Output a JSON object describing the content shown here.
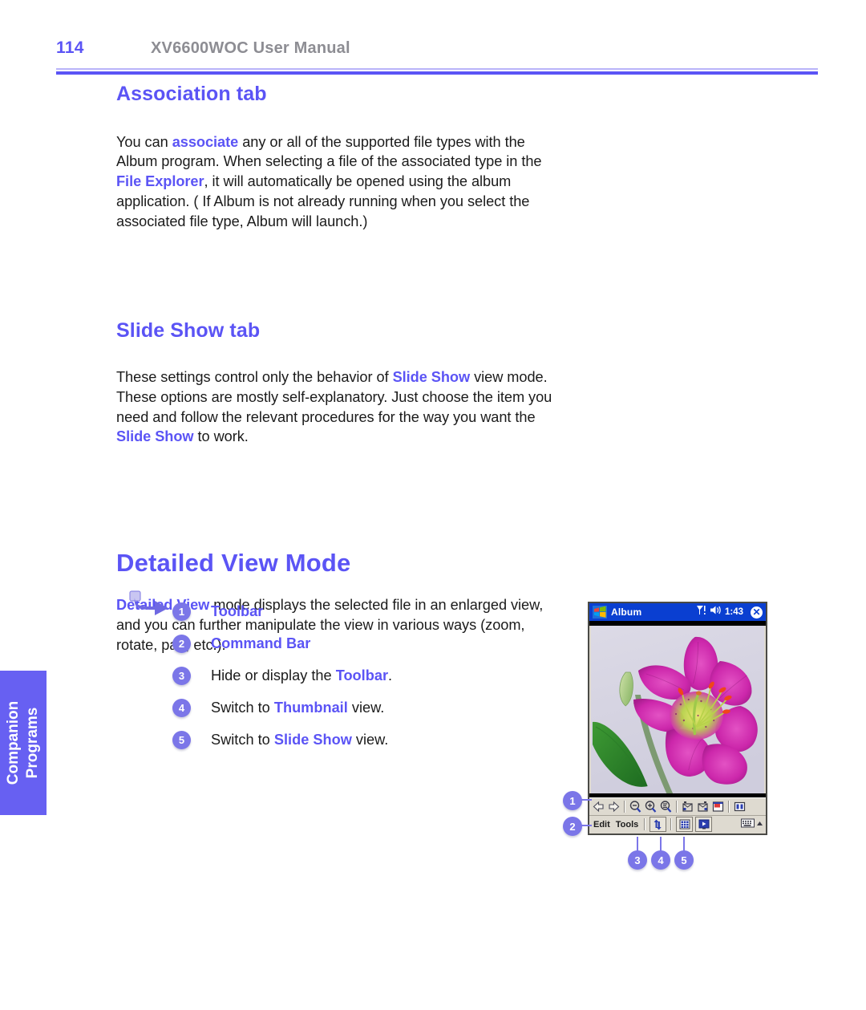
{
  "header": {
    "page_number": "114",
    "manual_title": "XV6600WOC User Manual"
  },
  "sections": {
    "association": {
      "heading": "Association tab",
      "para": {
        "t1": "You can ",
        "h1": "associate",
        "t2": " any or all of the supported file types with the Album program. When selecting a file of the associated type in the ",
        "h2": "File Explorer",
        "t3": ", it will automatically be opened using the album application. ( If Album is not already running when you select the associated file type, Album will launch.)"
      }
    },
    "slideshow": {
      "heading": "Slide Show tab",
      "para": {
        "t1": "These settings control only the behavior of ",
        "h1": "Slide Show",
        "t2": " view mode. These options are mostly self-explanatory. Just choose the item you need and follow the relevant procedures for the way you want the ",
        "h2": "Slide Show",
        "t3": " to work."
      }
    },
    "detailed_view": {
      "heading": "Detailed View Mode",
      "para": {
        "h1": "Detailed View",
        "t1": " mode displays the selected file in an enlarged view, and you can further manipulate the view in various ways (zoom, rotate, pan, etc.)."
      }
    }
  },
  "legend": [
    {
      "num": "1",
      "pre": "",
      "hl": "Toolbar",
      "post": "",
      "all_bold": true
    },
    {
      "num": "2",
      "pre": "",
      "hl": "Command Bar",
      "post": "",
      "all_bold": true
    },
    {
      "num": "3",
      "pre": "Hide or display the ",
      "hl": "Toolbar",
      "post": ".",
      "all_bold": false
    },
    {
      "num": "4",
      "pre": "Switch to ",
      "hl": "Thumbnail",
      "post": " view.",
      "all_bold": false
    },
    {
      "num": "5",
      "pre": "Switch to ",
      "hl": "Slide Show",
      "post": " view.",
      "all_bold": false
    }
  ],
  "side_tab": {
    "line1": "Companion",
    "line2": "Programs"
  },
  "pda": {
    "app_name": "Album",
    "time": "1:43",
    "close_label": "✕",
    "icons": {
      "start": "windows-logo-icon",
      "signal": "signal-strength-icon",
      "volume": "speaker-icon",
      "close": "close-icon"
    },
    "toolbar_icons": [
      "back-arrow-icon",
      "forward-arrow-icon",
      "zoom-out-icon",
      "zoom-in-icon",
      "zoom-fit-icon",
      "rotate-left-icon",
      "rotate-right-icon",
      "fullscreen-icon",
      "split-view-icon"
    ],
    "commandbar": {
      "edit_label": "Edit",
      "tools_label": "Tools",
      "toggle_toolbar_icon": "up-down-arrow-icon",
      "thumbnail_icon": "thumbnail-grid-icon",
      "slideshow_icon": "slideshow-icon",
      "keyboard_icon": "keyboard-icon",
      "chevron_icon": "chevron-up-icon"
    }
  },
  "callouts": [
    {
      "id": "1",
      "label": "1"
    },
    {
      "id": "2",
      "label": "2"
    },
    {
      "id": "3",
      "label": "3"
    },
    {
      "id": "4",
      "label": "4"
    },
    {
      "id": "5",
      "label": "5"
    }
  ],
  "colors": {
    "accent": "#5B54F5",
    "badge": "#7b76e8",
    "header_gray": "#8d8d93",
    "titlebar_blue": "#0a3fd1"
  }
}
